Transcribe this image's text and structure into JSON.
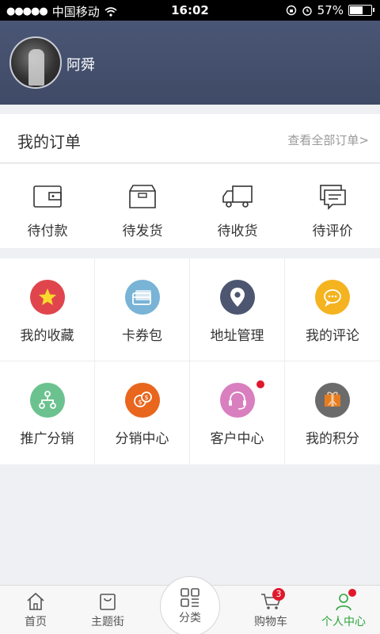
{
  "status_bar": {
    "carrier": "中国移动",
    "time": "16:02",
    "battery": "57%",
    "battery_level": 0.57
  },
  "profile": {
    "username": "阿舜"
  },
  "orders": {
    "title": "我的订单",
    "view_all": "查看全部订单>",
    "items": [
      {
        "label": "待付款",
        "icon": "wallet-icon"
      },
      {
        "label": "待发货",
        "icon": "box-icon"
      },
      {
        "label": "待收货",
        "icon": "truck-icon"
      },
      {
        "label": "待评价",
        "icon": "comment-icon"
      }
    ]
  },
  "services": [
    {
      "label": "我的收藏",
      "icon": "star-icon",
      "color": "#e0454d"
    },
    {
      "label": "卡券包",
      "icon": "card-icon",
      "color": "#79b3d6"
    },
    {
      "label": "地址管理",
      "icon": "location-icon",
      "color": "#4c5670"
    },
    {
      "label": "我的评论",
      "icon": "chat-icon",
      "color": "#f4b31f"
    },
    {
      "label": "推广分销",
      "icon": "org-icon",
      "color": "#6cc28f"
    },
    {
      "label": "分销中心",
      "icon": "coins-icon",
      "color": "#e8661d"
    },
    {
      "label": "客户中心",
      "icon": "headset-icon",
      "color": "#d97fbf"
    },
    {
      "label": "我的积分",
      "icon": "gift-icon",
      "color": "#6b6b6b"
    }
  ],
  "tabbar": {
    "items": [
      {
        "label": "首页",
        "icon": "home-icon"
      },
      {
        "label": "主题街",
        "icon": "bag-icon"
      },
      {
        "label": "分类",
        "icon": "grid-icon"
      },
      {
        "label": "购物车",
        "icon": "cart-icon",
        "badge": "3"
      },
      {
        "label": "个人中心",
        "icon": "person-icon",
        "active": true
      }
    ]
  },
  "colors": {
    "header": "#465270",
    "accent_green": "#2aa53c",
    "badge_red": "#e0182d"
  }
}
